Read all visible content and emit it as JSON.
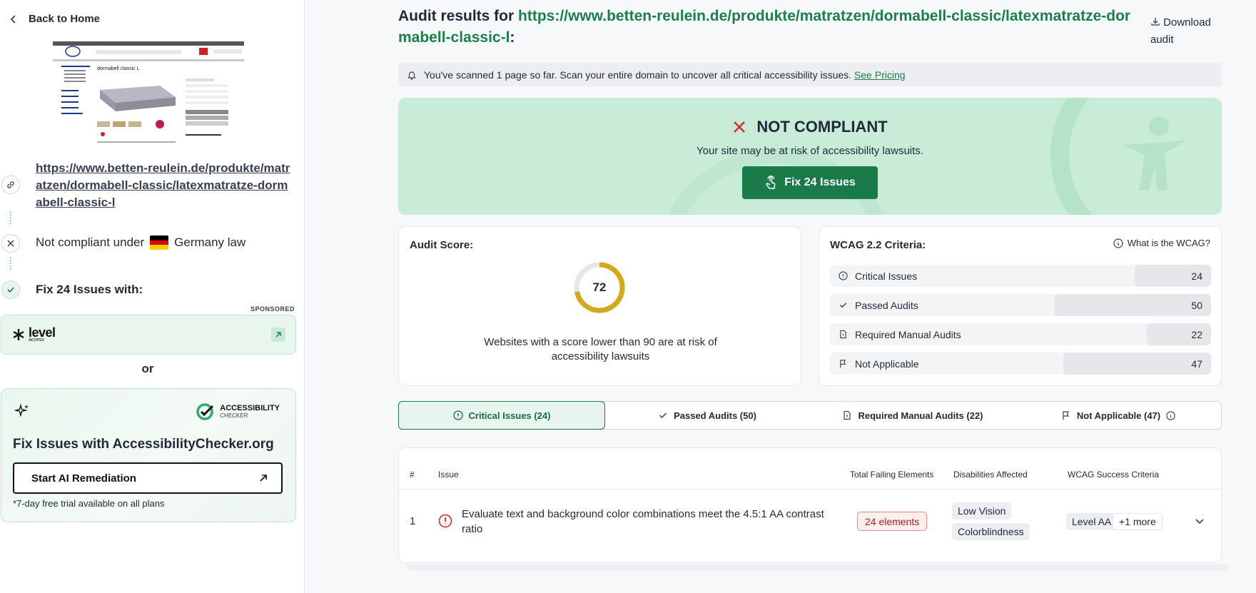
{
  "sidebar": {
    "back_label": "Back to Home",
    "url": "https://www.betten-reulein.de/produkte/matratzen/dormabell-classic/latexmatratze-dormabell-classic-l",
    "law_prefix": "Not compliant under",
    "law_country": "Germany law",
    "fix_with": "Fix 24 Issues with:",
    "sponsored": "SPONSORED",
    "sponsor_logo_word": "level",
    "sponsor_logo_sub": "access",
    "or": "or",
    "ac_logo_line1": "ACCESSIBILITY",
    "ac_logo_line2": "CHECKER",
    "ac_title": "Fix Issues with AccessibilityChecker.org",
    "ac_button": "Start AI Remediation",
    "ac_note": "*7-day free trial available on all plans"
  },
  "preview": {
    "product_heading": "dormabell classic L"
  },
  "header": {
    "title_prefix": "Audit results for",
    "title_url": "https://www.betten-reulein.de/produkte/matratzen/dormabell-classic/latexmatratze-dormabell-classic-l",
    "title_suffix": ":",
    "download_label": "Download audit"
  },
  "notice": {
    "text": "You've scanned 1 page so far. Scan your entire domain to uncover all critical accessibility issues.",
    "link": "See Pricing"
  },
  "hero": {
    "status": "NOT COMPLIANT",
    "subtitle": "Your site may be at risk of accessibility lawsuits.",
    "button": "Fix 24 Issues"
  },
  "score": {
    "label": "Audit Score:",
    "value": 72,
    "max": 100,
    "text": "Websites with a score lower than 90 are at risk of accessibility lawsuits"
  },
  "wcag": {
    "label": "WCAG 2.2 Criteria:",
    "help": "What is the WCAG?",
    "rows": [
      {
        "label": "Critical Issues",
        "value": "24",
        "icon": "alert-circle-icon"
      },
      {
        "label": "Passed Audits",
        "value": "50",
        "icon": "check-icon"
      },
      {
        "label": "Required Manual Audits",
        "value": "22",
        "icon": "document-icon"
      },
      {
        "label": "Not Applicable",
        "value": "47",
        "icon": "flag-icon"
      }
    ]
  },
  "tabs": [
    {
      "label": "Critical Issues (24)",
      "icon": "alert-circle-icon",
      "active": true
    },
    {
      "label": "Passed Audits (50)",
      "icon": "check-icon",
      "active": false
    },
    {
      "label": "Required Manual Audits (22)",
      "icon": "document-icon",
      "active": false
    },
    {
      "label": "Not Applicable (47)",
      "icon": "flag-icon",
      "active": false
    }
  ],
  "table": {
    "headers": [
      "#",
      "Issue",
      "Total Failing Elements",
      "Disabilities Affected",
      "WCAG Success Criteria"
    ],
    "rows": [
      {
        "num": "1",
        "issue": "Evaluate text and background color combinations meet the 4.5:1 AA contrast ratio",
        "failing": "24 elements",
        "disabilities": [
          "Low Vision",
          "Colorblindness"
        ],
        "criteria": "Level AA",
        "more": "+1 more"
      }
    ]
  },
  "colors": {
    "brand_green": "#1b7a4a",
    "hero_bg": "#c9ecd9",
    "error_red": "#d62e2e",
    "gauge_gold": "#d4a91c"
  }
}
